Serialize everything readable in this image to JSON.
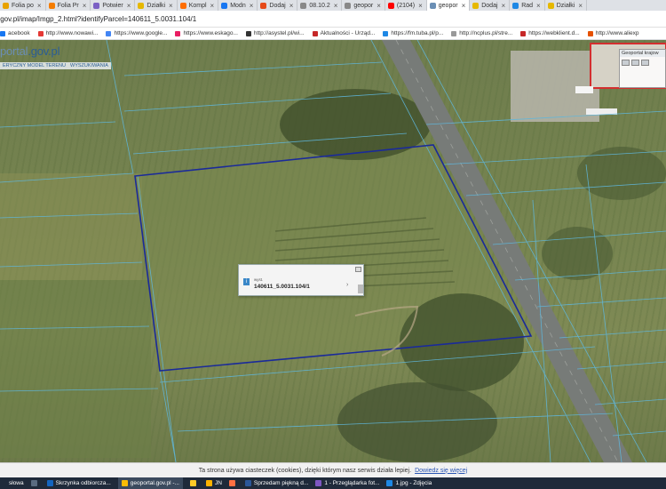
{
  "tabs": [
    {
      "label": "Folia po",
      "color": "#e8a200"
    },
    {
      "label": "Folia Pr",
      "color": "#f57c00"
    },
    {
      "label": "Potwier",
      "color": "#7b61c4"
    },
    {
      "label": "Działki",
      "color": "#e6b800"
    },
    {
      "label": "Kompl",
      "color": "#ff6d00"
    },
    {
      "label": "Modn",
      "color": "#1877f2"
    },
    {
      "label": "Dodaj",
      "color": "#e64a19"
    },
    {
      "label": "08.10.2",
      "color": "#888888"
    },
    {
      "label": "geopor",
      "color": "#888888"
    },
    {
      "label": "(2104)",
      "color": "#ff0000"
    },
    {
      "label": "geopor",
      "color": "#6b8fb5",
      "active": true
    },
    {
      "label": "Dodaj",
      "color": "#e6b800"
    },
    {
      "label": "Rad",
      "color": "#1e88e5"
    },
    {
      "label": "Działki",
      "color": "#e6b800"
    }
  ],
  "address": {
    "url": "s.gov.pl/imap/Imgp_2.html?identifyParcel=140611_5.0031.104/1"
  },
  "bookmarks": [
    {
      "label": "acebook",
      "color": "#1877f2"
    },
    {
      "label": "http://www.nowawi...",
      "color": "#e53935"
    },
    {
      "label": "https://www.google...",
      "color": "#4285f4"
    },
    {
      "label": "https://www.eskago...",
      "color": "#e91e63"
    },
    {
      "label": "http://asystel.pl/wi...",
      "color": "#333333"
    },
    {
      "label": "Aktualności - Urząd...",
      "color": "#c62828"
    },
    {
      "label": "https://fm.tuba.pl/p...",
      "color": "#1e88e5"
    },
    {
      "label": "http://ncplus.pl/stre...",
      "color": "#999999"
    },
    {
      "label": "https://webklient.d...",
      "color": "#c62828"
    },
    {
      "label": "http://www.aliexp",
      "color": "#e65100"
    }
  ],
  "map": {
    "logo_main": "portal",
    "logo_suffix": ".gov.pl",
    "model_items": [
      "ERYCZNY MODEL TERENU",
      "WYSZUKIWANIA"
    ],
    "mini_panel_title": "Geoportal krajow",
    "popup": {
      "label": "wyst.",
      "parcel_id": "140611_5.0031.104/1"
    }
  },
  "cookie": {
    "text": "Ta strona używa ciasteczek (cookies), dzięki którym nasz serwis działa lepiej.",
    "link": "Dowiedz się więcej"
  },
  "taskbar": [
    {
      "label": "słowa",
      "color": "#1f2a3a"
    },
    {
      "label": "",
      "color": "#5a6b80"
    },
    {
      "label": "Skrzynka odbiorcza...",
      "color": "#1565c0"
    },
    {
      "label": "geoportal.gov.pl -...",
      "color": "#fbbc05",
      "active": true
    },
    {
      "label": "",
      "color": "#ffca28"
    },
    {
      "label": "JN",
      "color": "#ffb300"
    },
    {
      "label": "",
      "color": "#ff7043"
    },
    {
      "label": "Sprzedam piękną d...",
      "color": "#2b579a"
    },
    {
      "label": "1 - Przeglądarka fot...",
      "color": "#7e57c2"
    },
    {
      "label": "1.jpg - Zdjęcia",
      "color": "#1e88e5"
    }
  ]
}
